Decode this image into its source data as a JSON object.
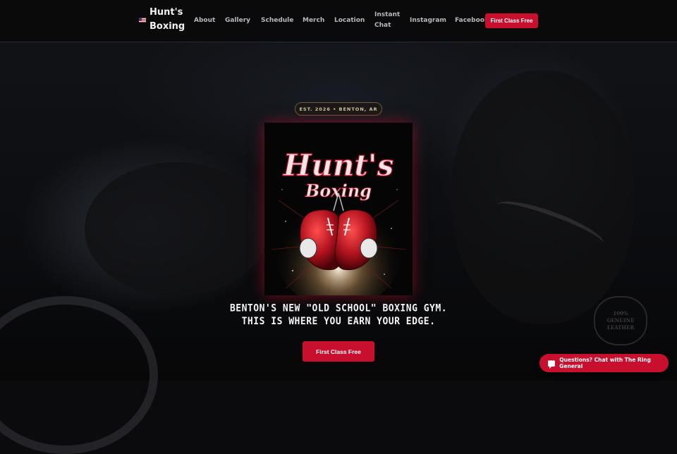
{
  "brand": {
    "name_line1": "Hunt's",
    "name_line2": "Boxing",
    "flag_icon": "us-flag-icon"
  },
  "nav": {
    "items": [
      {
        "label": "About"
      },
      {
        "label": "Gallery"
      },
      {
        "label": "Schedule"
      },
      {
        "label": "Merch"
      },
      {
        "label": "Location"
      },
      {
        "label_line1": "Instant",
        "label_line2": "Chat"
      },
      {
        "label": "Instagram"
      },
      {
        "label": "Facebook"
      }
    ],
    "cta": "First Class Free"
  },
  "hero": {
    "badge": "EST. 2026 • BENTON, AR",
    "logo": {
      "title": "Hunt's",
      "subtitle": "Boxing"
    },
    "tagline_line1": "BENTON'S NEW \"OLD SCHOOL\" BOXING GYM.",
    "tagline_line2": "THIS IS WHERE YOU EARN YOUR EDGE.",
    "cta": "First Class Free"
  },
  "watermark": {
    "line1": "100%",
    "line2": "GENUINE",
    "line3": "LEATHER"
  },
  "chat_widget": {
    "label": "Questions? Chat with The Ring General",
    "icon": "chat-bubble-icon"
  },
  "colors": {
    "accent": "#c8102e",
    "background": "#0b0b0d",
    "badge_border": "#6d5a38"
  }
}
